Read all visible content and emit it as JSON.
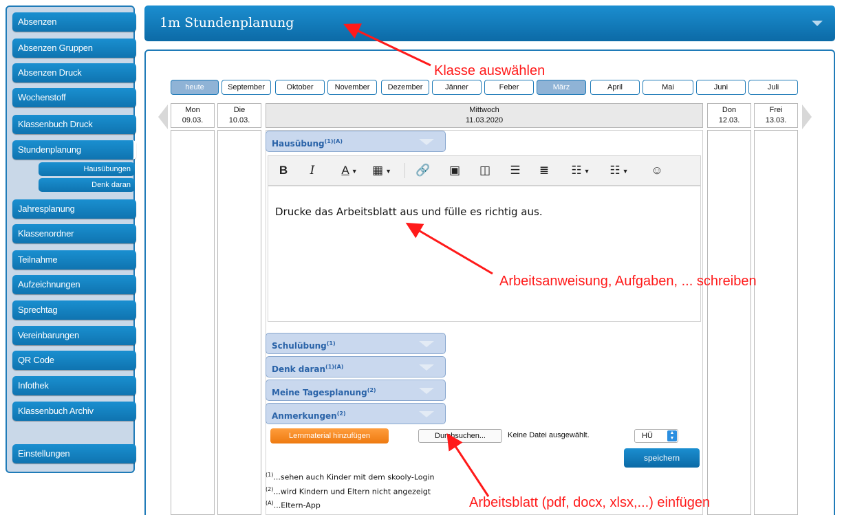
{
  "sidebar": {
    "items": [
      {
        "label": "Absenzen"
      },
      {
        "label": "Absenzen Gruppen"
      },
      {
        "label": "Absenzen Druck"
      },
      {
        "label": "Wochenstoff"
      },
      {
        "label": "Klassenbuch Druck"
      },
      {
        "label": "Stundenplanung"
      },
      {
        "label": "Jahresplanung"
      },
      {
        "label": "Klassenordner"
      },
      {
        "label": "Teilnahme"
      },
      {
        "label": "Aufzeichnungen"
      },
      {
        "label": "Sprechtag"
      },
      {
        "label": "Vereinbarungen"
      },
      {
        "label": "QR Code"
      },
      {
        "label": "Infothek"
      },
      {
        "label": "Klassenbuch Archiv"
      },
      {
        "label": "Einstellungen"
      }
    ],
    "subitems": [
      {
        "label": "Hausübungen"
      },
      {
        "label": "Denk daran"
      }
    ]
  },
  "header": {
    "title": "1m Stundenplanung"
  },
  "months": [
    "heute",
    "September",
    "Oktober",
    "November",
    "Dezember",
    "Jänner",
    "Feber",
    "März",
    "April",
    "Mai",
    "Juni",
    "Juli"
  ],
  "days": [
    {
      "name": "Mon",
      "date": "09.03."
    },
    {
      "name": "Die",
      "date": "10.03."
    },
    {
      "name": "Mittwoch",
      "date": "11.03.2020"
    },
    {
      "name": "Don",
      "date": "12.03."
    },
    {
      "name": "Frei",
      "date": "13.03."
    }
  ],
  "sections": {
    "hausuebung": {
      "label": "Hausübung",
      "sup": "(1)(A)"
    },
    "schuluebung": {
      "label": "Schulübung",
      "sup": "(1)"
    },
    "denk_daran": {
      "label": "Denk daran",
      "sup": "(1)(A)"
    },
    "tagesplanung": {
      "label": "Meine Tagesplanung",
      "sup": "(2)"
    },
    "anmerkungen": {
      "label": "Anmerkungen",
      "sup": "(2)"
    }
  },
  "toolbar": {
    "bold": "B",
    "italic": "I",
    "font_color": "A",
    "emoji": "☺"
  },
  "editor": {
    "text": "Drucke das Arbeitsblatt aus und fülle es richtig aus."
  },
  "controls": {
    "lernmaterial": "Lernmaterial hinzufügen",
    "browse": "Durchsuchen...",
    "no_file": "Keine Datei ausgewählt.",
    "type_select": "HÜ",
    "save": "speichern"
  },
  "footnotes": [
    {
      "mark": "(1)",
      "text": "...sehen auch Kinder mit dem skooly-Login"
    },
    {
      "mark": "(2)",
      "text": "...wird Kindern und Eltern nicht angezeigt"
    },
    {
      "mark": "(A)",
      "text": "...Eltern-App"
    }
  ],
  "annotations": {
    "klasse": "Klasse auswählen",
    "anweisung": "Arbeitsanweisung, Aufgaben, ... schreiben",
    "arbeitsblatt": "Arbeitsblatt (pdf, docx, xlsx,...) einfügen"
  },
  "colors": {
    "accent": "#1a8fd0",
    "annotation": "#ff1a1a",
    "orange": "#ee7a10",
    "section_bg": "#c9d8ee"
  }
}
